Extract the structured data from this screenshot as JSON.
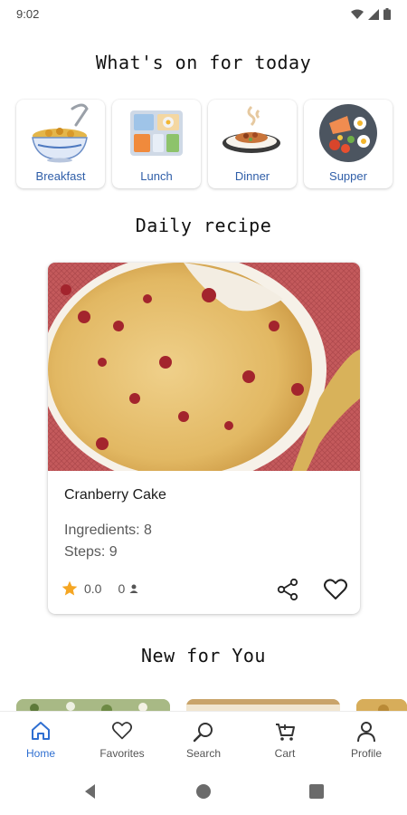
{
  "status_bar": {
    "time": "9:02"
  },
  "colors": {
    "accent": "#2f6fd1",
    "category_text": "#2f5ea8",
    "star": "#f5a623"
  },
  "sections": {
    "today_title": "What's on for today",
    "daily_title": "Daily recipe",
    "new_title": "New for You"
  },
  "categories": [
    {
      "label": "Breakfast",
      "icon": "cereal-bowl-icon"
    },
    {
      "label": "Lunch",
      "icon": "lunch-tray-icon"
    },
    {
      "label": "Dinner",
      "icon": "dinner-plate-icon"
    },
    {
      "label": "Supper",
      "icon": "supper-platter-icon"
    }
  ],
  "daily_recipe": {
    "name": "Cranberry Cake",
    "ingredients": "Ingredients: 8",
    "steps": "Steps: 9",
    "rating": "0.0",
    "ratings_count": "0"
  },
  "bottom_nav": [
    {
      "label": "Home",
      "icon": "home-icon",
      "active": true
    },
    {
      "label": "Favorites",
      "icon": "heart-icon",
      "active": false
    },
    {
      "label": "Search",
      "icon": "search-icon",
      "active": false
    },
    {
      "label": "Cart",
      "icon": "cart-icon",
      "active": false
    },
    {
      "label": "Profile",
      "icon": "profile-icon",
      "active": false
    }
  ]
}
